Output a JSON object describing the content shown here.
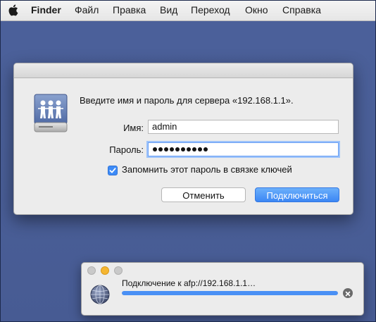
{
  "menubar": {
    "apple_icon": "apple-logo-icon",
    "items": [
      "Finder",
      "Файл",
      "Правка",
      "Вид",
      "Переход",
      "Окно",
      "Справка"
    ]
  },
  "dialog": {
    "icon": "shared-server-icon",
    "prompt": "Введите имя и пароль для сервера «192.168.1.1».",
    "name_label": "Имя:",
    "name_value": "admin",
    "password_label": "Пароль:",
    "password_length": 10,
    "remember_checked": true,
    "remember_label": "Запомнить этот пароль в связке ключей",
    "cancel_label": "Отменить",
    "connect_label": "Подключиться"
  },
  "progress_window": {
    "icon": "network-globe-icon",
    "status_text": "Подключение к afp://192.168.1.1…",
    "progress": 1.0,
    "stop_icon": "stop-icon"
  },
  "colors": {
    "desktop": "#485c95",
    "accent": "#3d8bf7",
    "traffic_close": "#c8c8c8",
    "traffic_minimize": "#f5b631",
    "traffic_zoom": "#c8c8c8"
  }
}
